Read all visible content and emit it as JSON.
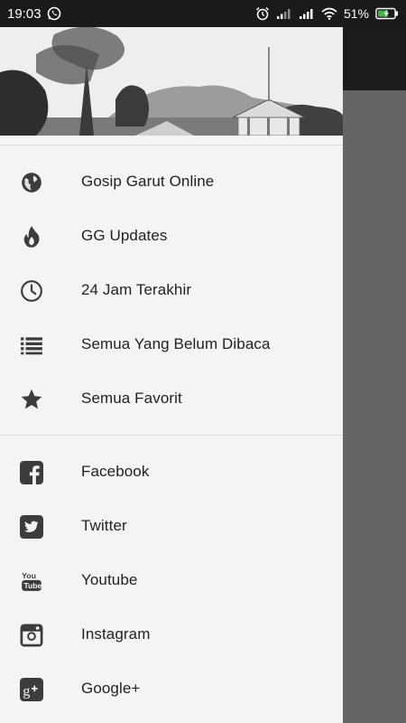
{
  "status_bar": {
    "time": "19:03",
    "battery": "51%",
    "icons": [
      "whatsapp-icon",
      "alarm-icon",
      "signal-icon",
      "signal-icon",
      "wifi-icon",
      "battery-icon"
    ]
  },
  "drawer": {
    "header_image": "landscape-photo-with-gazebo",
    "main_items": [
      {
        "label": "Gosip Garut Online",
        "icon": "globe-icon"
      },
      {
        "label": "GG Updates",
        "icon": "flame-icon"
      },
      {
        "label": "24 Jam Terakhir",
        "icon": "clock-icon"
      },
      {
        "label": "Semua Yang Belum Dibaca",
        "icon": "list-icon"
      },
      {
        "label": "Semua Favorit",
        "icon": "star-icon"
      }
    ],
    "social_items": [
      {
        "label": "Facebook",
        "icon": "facebook-icon"
      },
      {
        "label": "Twitter",
        "icon": "twitter-icon"
      },
      {
        "label": "Youtube",
        "icon": "youtube-icon"
      },
      {
        "label": "Instagram",
        "icon": "instagram-icon"
      },
      {
        "label": "Google+",
        "icon": "google-plus-icon"
      }
    ]
  },
  "colors": {
    "drawer_bg": "#f4f4f4",
    "scrim": "#656565",
    "status_bar": "#1a1a1a",
    "icon": "#3c3c3c",
    "battery_accent": "#4caf50"
  }
}
